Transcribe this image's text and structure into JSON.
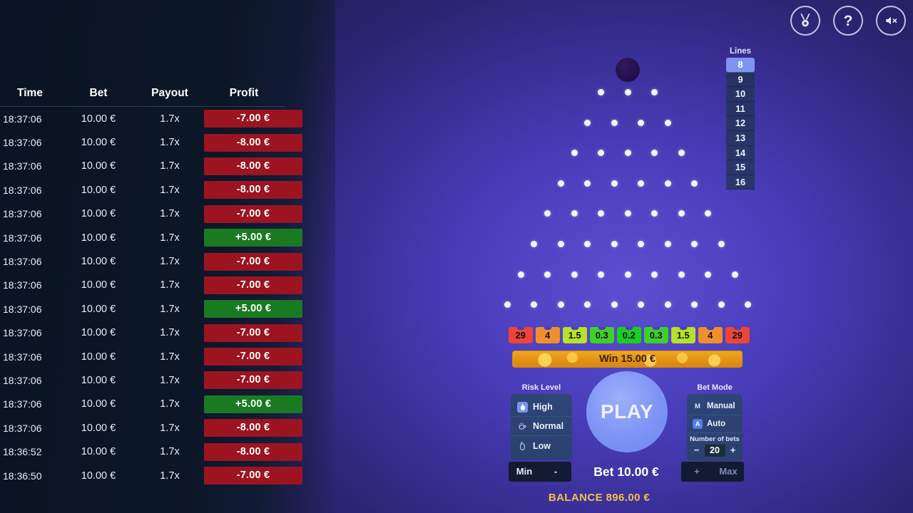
{
  "top_bar": {
    "buttons": [
      {
        "name": "achievements",
        "icon": "medal-icon",
        "label": ""
      },
      {
        "name": "help",
        "icon": "question-mark-icon",
        "label": "?"
      },
      {
        "name": "sound",
        "icon": "speaker-muted-icon",
        "label": ""
      }
    ]
  },
  "history": {
    "columns": [
      "Time",
      "Bet",
      "Payout",
      "Profit"
    ],
    "rows": [
      {
        "time": "18:37:06",
        "bet": "10.00 €",
        "payout": "1.7x",
        "profit": "-7.00 €",
        "result": "loss"
      },
      {
        "time": "18:37:06",
        "bet": "10.00 €",
        "payout": "1.7x",
        "profit": "-8.00 €",
        "result": "loss"
      },
      {
        "time": "18:37:06",
        "bet": "10.00 €",
        "payout": "1.7x",
        "profit": "-8.00 €",
        "result": "loss"
      },
      {
        "time": "18:37:06",
        "bet": "10.00 €",
        "payout": "1.7x",
        "profit": "-8.00 €",
        "result": "loss"
      },
      {
        "time": "18:37:06",
        "bet": "10.00 €",
        "payout": "1.7x",
        "profit": "-7.00 €",
        "result": "loss"
      },
      {
        "time": "18:37:06",
        "bet": "10.00 €",
        "payout": "1.7x",
        "profit": "+5.00 €",
        "result": "win"
      },
      {
        "time": "18:37:06",
        "bet": "10.00 €",
        "payout": "1.7x",
        "profit": "-7.00 €",
        "result": "loss"
      },
      {
        "time": "18:37:06",
        "bet": "10.00 €",
        "payout": "1.7x",
        "profit": "-7.00 €",
        "result": "loss"
      },
      {
        "time": "18:37:06",
        "bet": "10.00 €",
        "payout": "1.7x",
        "profit": "+5.00 €",
        "result": "win"
      },
      {
        "time": "18:37:06",
        "bet": "10.00 €",
        "payout": "1.7x",
        "profit": "-7.00 €",
        "result": "loss"
      },
      {
        "time": "18:37:06",
        "bet": "10.00 €",
        "payout": "1.7x",
        "profit": "-7.00 €",
        "result": "loss"
      },
      {
        "time": "18:37:06",
        "bet": "10.00 €",
        "payout": "1.7x",
        "profit": "-7.00 €",
        "result": "loss"
      },
      {
        "time": "18:37:06",
        "bet": "10.00 €",
        "payout": "1.7x",
        "profit": "+5.00 €",
        "result": "win"
      },
      {
        "time": "18:37:06",
        "bet": "10.00 €",
        "payout": "1.7x",
        "profit": "-8.00 €",
        "result": "loss"
      },
      {
        "time": "18:36:52",
        "bet": "10.00 €",
        "payout": "1.7x",
        "profit": "-8.00 €",
        "result": "loss"
      },
      {
        "time": "18:36:50",
        "bet": "10.00 €",
        "payout": "1.7x",
        "profit": "-7.00 €",
        "result": "loss"
      }
    ]
  },
  "lines": {
    "title": "Lines",
    "options": [
      "8",
      "9",
      "10",
      "11",
      "12",
      "13",
      "14",
      "15",
      "16"
    ],
    "selected": "8"
  },
  "board": {
    "rows_peg_counts": [
      3,
      4,
      5,
      6,
      7,
      8,
      9,
      10
    ],
    "ball_present": true
  },
  "multipliers": {
    "values": [
      "29",
      "4",
      "1.5",
      "0.3",
      "0.2",
      "0.3",
      "1.5",
      "4",
      "29"
    ],
    "colors": [
      "#ef4436",
      "#f0902c",
      "#b6e327",
      "#3fd128",
      "#19cf1f",
      "#3fd128",
      "#b6e327",
      "#f0902c",
      "#ef4436"
    ]
  },
  "win_banner": {
    "text": "Win 15.00 €"
  },
  "risk_level": {
    "title": "Risk Level",
    "options": [
      {
        "label": "High",
        "icon": "flame-icon",
        "selected": true
      },
      {
        "label": "Normal",
        "icon": "cup-icon",
        "selected": false
      },
      {
        "label": "Low",
        "icon": "lock-icon",
        "selected": false
      }
    ]
  },
  "bet_mode": {
    "title": "Bet Mode",
    "options": [
      {
        "label": "Manual",
        "badge": "M",
        "selected": false
      },
      {
        "label": "Auto",
        "badge": "A",
        "selected": true
      }
    ],
    "number_of_bets": {
      "label": "Number of bets",
      "value": "20",
      "minus": "−",
      "plus": "+"
    }
  },
  "play": {
    "label": "PLAY"
  },
  "bet_controls": {
    "min_label": "Min",
    "minus_label": "-",
    "amount": "Bet 10.00 €",
    "plus_label": "+",
    "max_label": "Max"
  },
  "balance": {
    "text": "BALANCE 896.00 €"
  },
  "theme": {
    "accent": "#8094f2",
    "loss": "#9b1420",
    "win": "#1a7a22",
    "gold": "#f0c14b"
  }
}
